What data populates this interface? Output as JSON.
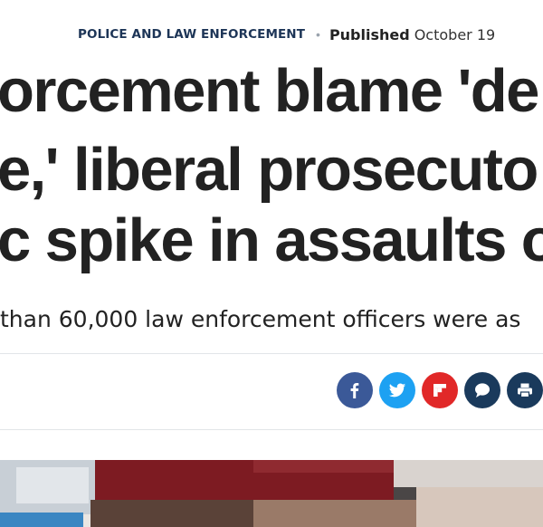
{
  "article": {
    "category": "POLICE AND LAW ENFORCEMENT",
    "published_label": "Published",
    "published_date": "October 19",
    "headline_lines": [
      "orcement blame 'de",
      "e,' liberal prosecuto",
      "c spike in assaults o"
    ],
    "subheadline": "than 60,000 law enforcement officers were as"
  },
  "share": {
    "buttons": [
      {
        "name": "facebook",
        "icon": "facebook-icon",
        "color": "#3b5998"
      },
      {
        "name": "twitter",
        "icon": "twitter-icon",
        "color": "#1da1f2"
      },
      {
        "name": "flipboard",
        "icon": "flipboard-icon",
        "color": "#e12828"
      },
      {
        "name": "comments",
        "icon": "comment-icon",
        "color": "#1a3a5c"
      },
      {
        "name": "print",
        "icon": "print-icon",
        "color": "#1a3a5c"
      }
    ]
  }
}
